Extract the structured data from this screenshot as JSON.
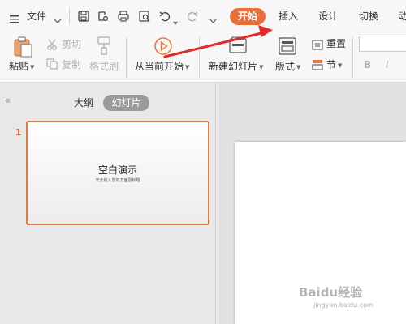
{
  "topbar": {
    "menu_label": "文件",
    "tabs": [
      "开始",
      "插入",
      "设计",
      "切换",
      "动"
    ]
  },
  "ribbon": {
    "paste": "粘贴",
    "cut": "剪切",
    "copy": "复制",
    "format_painter": "格式刷",
    "play_from_current": "从当前开始",
    "new_slide": "新建幻灯片",
    "layout": "版式",
    "reset": "重置",
    "section": "节",
    "bold": "B",
    "italic": "I"
  },
  "leftpane": {
    "collapse": "«",
    "outline": "大纲",
    "slides": "幻灯片"
  },
  "thumbnail": {
    "number": "1",
    "title": "空白演示",
    "subtitle": "开此输入您的方面副标题"
  },
  "watermark": {
    "brand": "Baidu经验",
    "url": "jingyan.baidu.com"
  },
  "colors": {
    "accent_orange": "#e8703a",
    "arrow_red": "#e02b2b"
  }
}
